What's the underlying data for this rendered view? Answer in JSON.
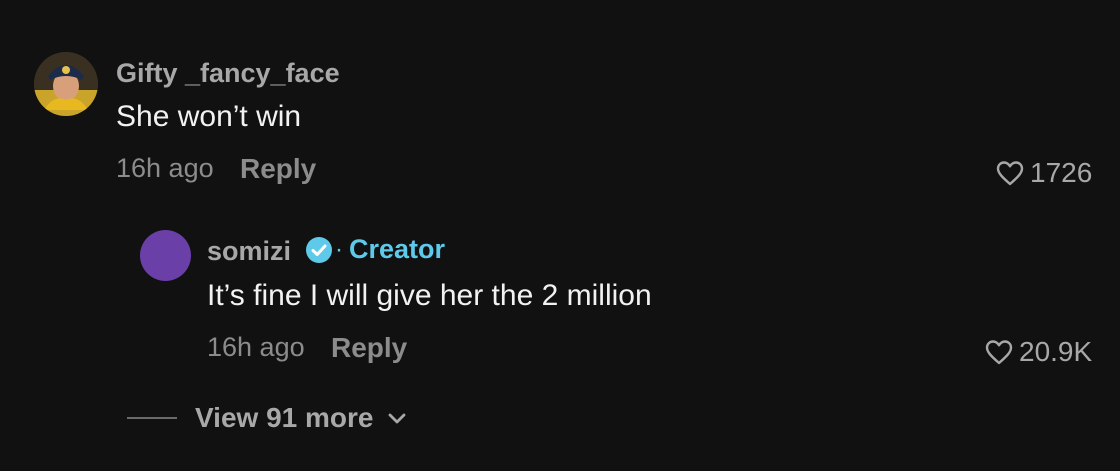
{
  "comments": [
    {
      "username": "Gifty _fancy_face",
      "text": "She won’t win",
      "time": "16h ago",
      "reply_label": "Reply",
      "likes": "1726",
      "avatar_icon": "profile-photo"
    }
  ],
  "replies": [
    {
      "username": "somizi",
      "verified_icon": "verified-check-icon",
      "badge_label": "Creator",
      "text": "It’s fine I will give her the 2 million",
      "time": "16h ago",
      "reply_label": "Reply",
      "likes": "20.9K",
      "avatar_color": "#6a3fa8"
    }
  ],
  "view_more": {
    "label": "View 91 more",
    "icon": "chevron-down-icon"
  },
  "colors": {
    "background": "#111111",
    "creator_accent": "#5fc9ea",
    "muted_text": "#8c8c8c"
  }
}
